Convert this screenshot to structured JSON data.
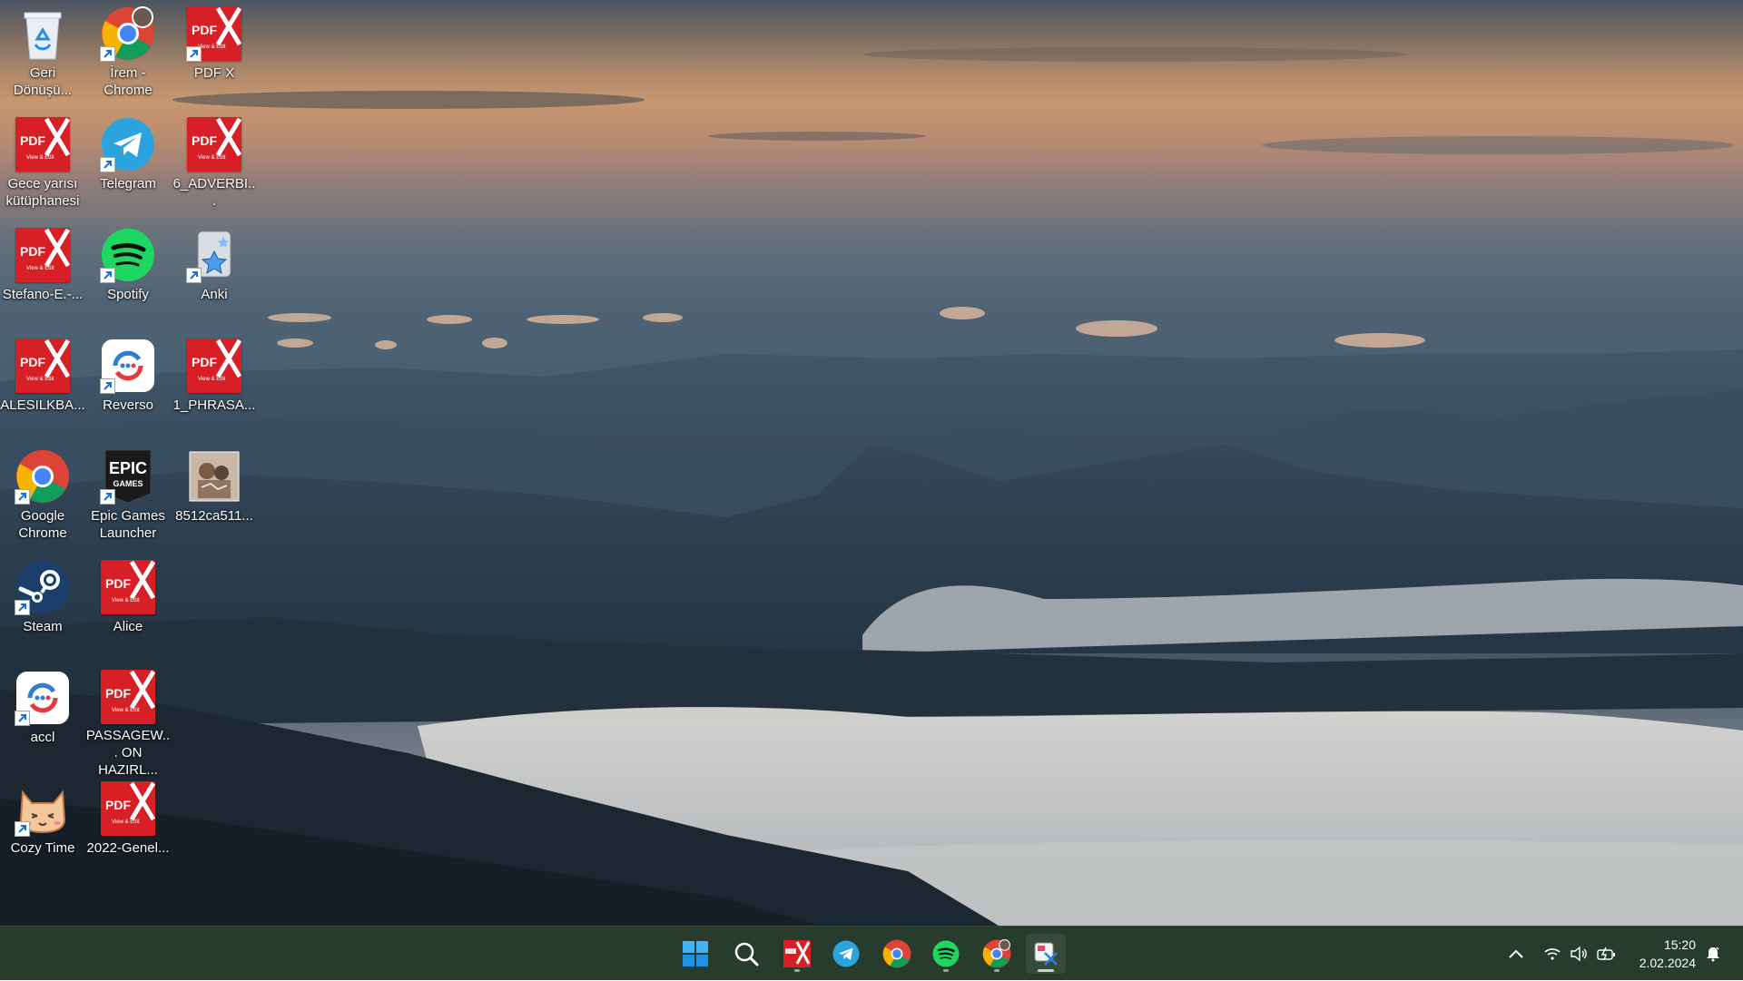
{
  "desktop": {
    "icons": [
      {
        "label": "Geri Dönüşü...",
        "icon": "recycle-bin-icon"
      },
      {
        "label": "İrem - Chrome",
        "icon": "chrome-profile-icon"
      },
      {
        "label": "PDF X",
        "icon": "pdfx-icon"
      },
      {
        "label": "Gece yarısı kütüphanesi",
        "icon": "pdfx-icon"
      },
      {
        "label": "Telegram",
        "icon": "telegram-icon"
      },
      {
        "label": "6_ADVERBI...",
        "icon": "pdfx-icon"
      },
      {
        "label": "Stefano-E.-...",
        "icon": "pdfx-icon"
      },
      {
        "label": "Spotify",
        "icon": "spotify-icon"
      },
      {
        "label": "Anki",
        "icon": "anki-icon"
      },
      {
        "label": "ALESILKBA...",
        "icon": "pdfx-icon"
      },
      {
        "label": "Reverso",
        "icon": "reverso-icon"
      },
      {
        "label": "1_PHRASA...",
        "icon": "pdfx-icon"
      },
      {
        "label": "Google Chrome",
        "icon": "chrome-icon"
      },
      {
        "label": "Epic Games Launcher",
        "icon": "epic-games-icon"
      },
      {
        "label": "8512ca511...",
        "icon": "image-thumbnail-icon"
      },
      {
        "label": "Steam",
        "icon": "steam-icon"
      },
      {
        "label": "Alice",
        "icon": "pdfx-icon"
      },
      {
        "label": "accl",
        "icon": "reverso-icon"
      },
      {
        "label": "PASSAGEW... ON HAZIRL...",
        "icon": "pdfx-icon"
      },
      {
        "label": "Cozy Time",
        "icon": "cozy-time-cat-icon"
      },
      {
        "label": "2022-Genel...",
        "icon": "pdfx-icon"
      }
    ],
    "pdf_icon_text": {
      "brand": "PDF",
      "subtitle": "View & Edit"
    },
    "epic_text": {
      "top": "EPIC",
      "bottom": "GAMES"
    }
  },
  "taskbar": {
    "apps": [
      "start-icon",
      "search-icon",
      "pdfx-icon",
      "telegram-icon",
      "chrome-icon",
      "spotify-icon",
      "chrome-profile-icon",
      "snipping-tool-icon"
    ],
    "time": "15:20",
    "date": "2.02.2024",
    "tray": [
      "chevron-up-icon",
      "wifi-icon",
      "volume-icon",
      "battery-icon",
      "notification-bell-icon"
    ]
  },
  "colors": {
    "taskbar_bg": "#273c2c",
    "pdfx_red": "#d71f26",
    "telegram_blue": "#2aa3df",
    "spotify_green": "#1ed760"
  }
}
